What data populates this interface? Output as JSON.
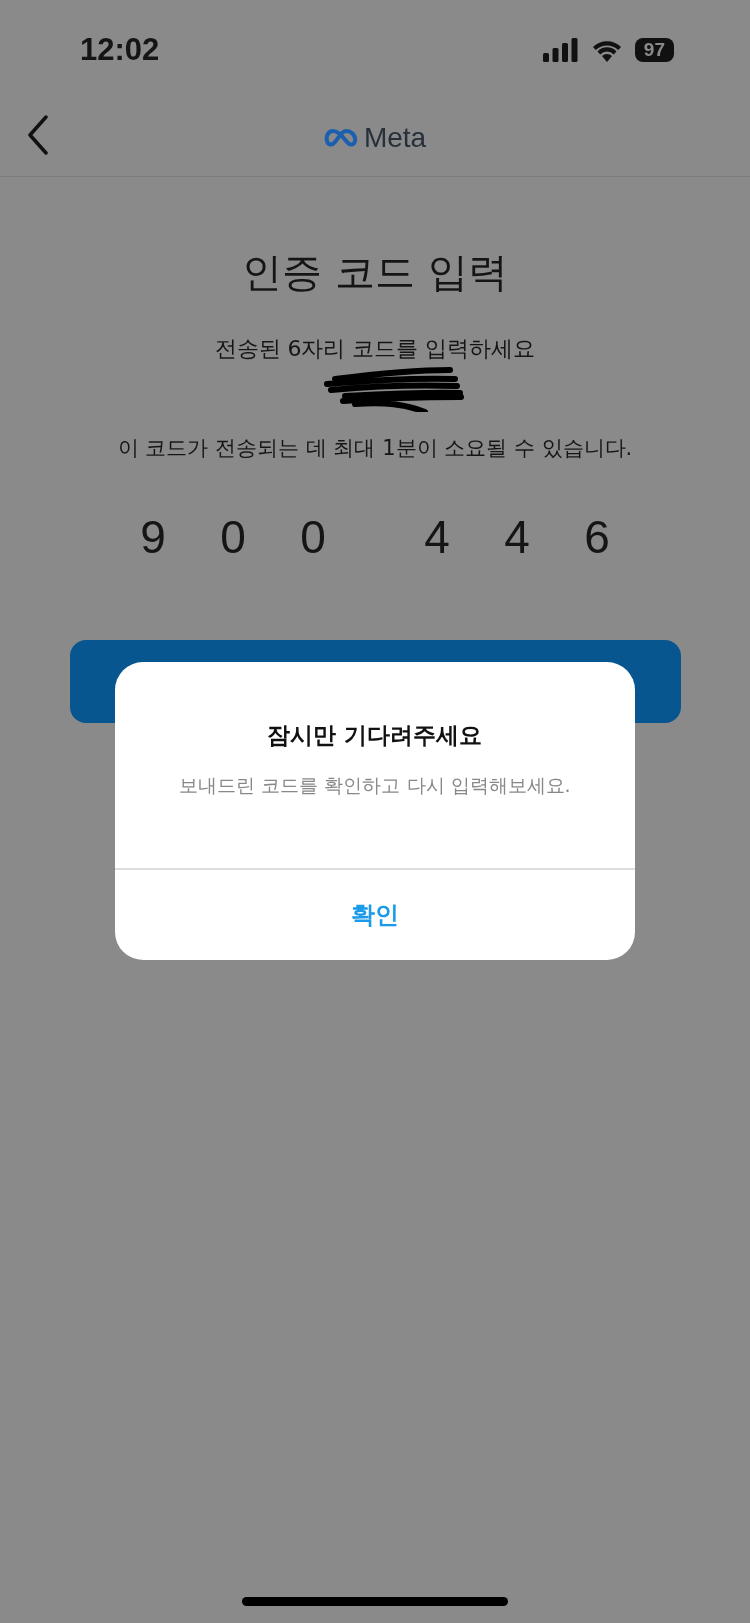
{
  "status_bar": {
    "time": "12:02",
    "battery": "97"
  },
  "header": {
    "logo": "Meta"
  },
  "title": "인증 코드 입력",
  "subtitle": "전송된 6자리 코드를 입력하세요",
  "note": "이 코드가 전송되는 데 최대 1분이 소요될 수 있습니다.",
  "code_digits": [
    "9",
    "0",
    "0",
    "4",
    "4",
    "6"
  ],
  "dialog": {
    "title": "잠시만 기다려주세요",
    "message": "보내드린 코드를 확인하고 다시 입력해보세요.",
    "button": "확인"
  }
}
